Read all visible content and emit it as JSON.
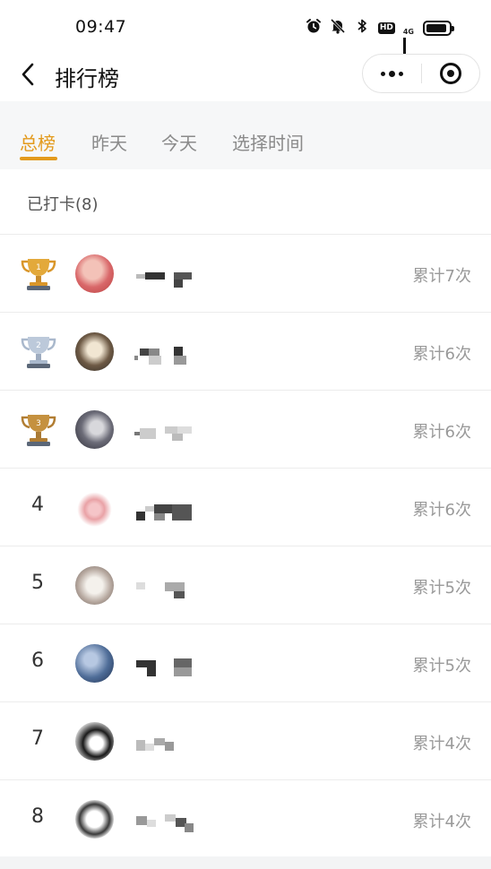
{
  "status_bar": {
    "time": "09:47",
    "icons": [
      "alarm-icon",
      "mute-icon",
      "bluetooth-icon",
      "hd-icon",
      "signal-4g-icon",
      "battery-icon"
    ],
    "hd_label": "HD",
    "network_label": "4G",
    "battery_level": 0.9
  },
  "header": {
    "title": "排行榜",
    "back_icon": "chevron-left-icon",
    "capsule": {
      "more_icon": "more-dots-icon",
      "close_icon": "target-close-icon"
    }
  },
  "tabs": [
    {
      "label": "总榜",
      "active": true
    },
    {
      "label": "昨天",
      "active": false
    },
    {
      "label": "今天",
      "active": false
    },
    {
      "label": "选择时间",
      "active": false
    }
  ],
  "colors": {
    "accent": "#e39a1c",
    "gold": "#d9a03a",
    "silver": "#b7c4d6",
    "bronze": "#c08a3e",
    "muted": "#9a9a9a"
  },
  "summary": {
    "checked_label": "已打卡(8)"
  },
  "ranking": [
    {
      "rank": "1",
      "trophy": "gold-trophy-icon",
      "total": "累计7次"
    },
    {
      "rank": "2",
      "trophy": "silver-trophy-icon",
      "total": "累计6次"
    },
    {
      "rank": "3",
      "trophy": "bronze-trophy-icon",
      "total": "累计6次"
    },
    {
      "rank": "4",
      "trophy": null,
      "total": "累计6次"
    },
    {
      "rank": "5",
      "trophy": null,
      "total": "累计5次"
    },
    {
      "rank": "6",
      "trophy": null,
      "total": "累计5次"
    },
    {
      "rank": "7",
      "trophy": null,
      "total": "累计4次"
    },
    {
      "rank": "8",
      "trophy": null,
      "total": "累计4次"
    }
  ]
}
